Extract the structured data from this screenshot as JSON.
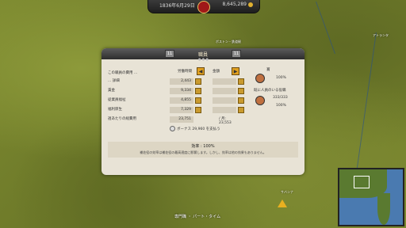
{
  "topbar": {
    "date": "1836年6月29日",
    "money": "8,645,289"
  },
  "map_labels": [
    "ボストン・鉄道駅",
    "アトランタ",
    "サバンナ",
    "パート・タイム"
  ],
  "panel": {
    "title": "職員",
    "nav_prev": "11",
    "nav_next": "11",
    "header_label": "この職員の費用 ...",
    "col_current": "労働時間",
    "col_target": "金額",
    "rows": [
      {
        "label": "... 詳細",
        "value": "2,443"
      },
      {
        "label": "賃金",
        "value": "9,334"
      },
      {
        "label": "従業員福祉",
        "value": "4,855"
      },
      {
        "label": "福利厚生",
        "value": "7,329"
      }
    ],
    "total_label": "週あたりの総費用",
    "total_value": "23,751",
    "total_extra": "/ 月: 23,553",
    "right_title": "賞",
    "right_pct1": "100%",
    "right_label2": "既に人員のいる役職",
    "right_count": "333/333",
    "right_pct2": "100%",
    "bonus_text": "ボーナス 29,960 を支払う",
    "efficiency_title": "効率 : 100%",
    "efficiency_desc": "補佐役の効率は補佐役の最高適度に影響します。しかし、効率は他の効果もありません。"
  },
  "bottom": {
    "label": "専門職 ・ パート・タイム"
  }
}
